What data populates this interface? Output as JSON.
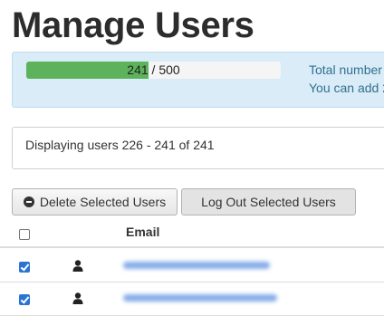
{
  "page": {
    "title": "Manage Users"
  },
  "quota": {
    "used": 241,
    "max": 500,
    "used_label": "241",
    "separator": " / ",
    "max_label": "500",
    "fill_fraction": 0.482,
    "info_line_1": "Total number",
    "info_line_2": "You can add 2"
  },
  "listing": {
    "display_text": "Displaying users 226 - 241 of 241"
  },
  "toolbar": {
    "delete_label": "Delete Selected Users",
    "logout_label": "Log Out Selected Users"
  },
  "table": {
    "columns": [
      "",
      "",
      "Email"
    ],
    "select_all_checked": false,
    "rows": [
      {
        "checked": true,
        "icon": "user-icon",
        "email": ""
      },
      {
        "checked": true,
        "icon": "user-icon",
        "email": ""
      }
    ]
  },
  "colors": {
    "progress_fill": "#5cb35c",
    "info_background": "#d9ecf7",
    "info_text": "#31708f",
    "checkbox_checked": "#2a72d6"
  }
}
